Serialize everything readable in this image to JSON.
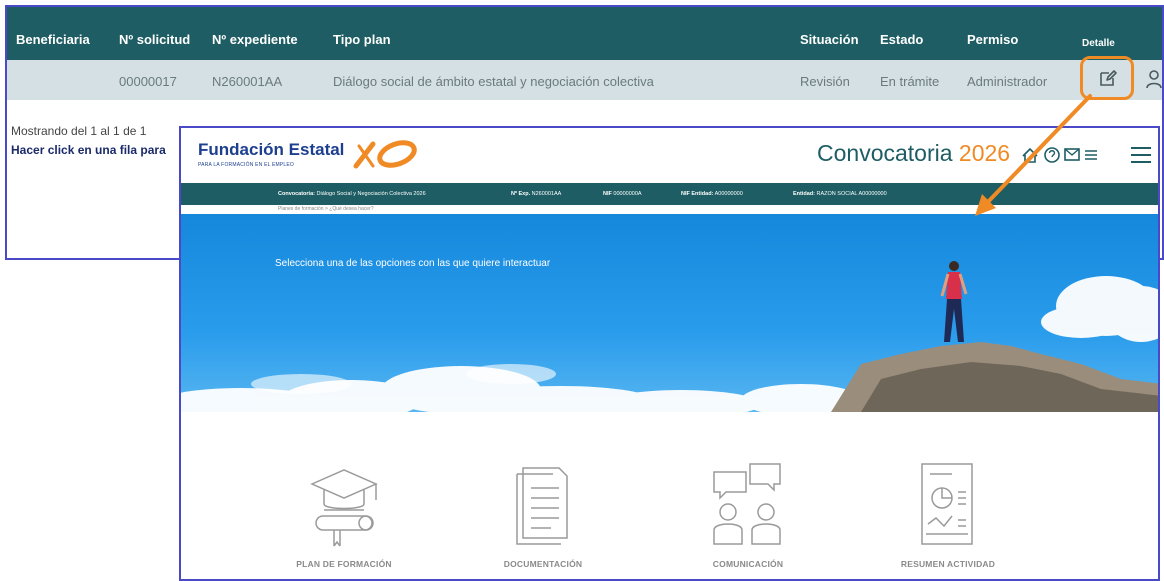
{
  "table": {
    "headers": {
      "beneficiaria": "Beneficiaria",
      "solicitud": "Nº solicitud",
      "expediente": "Nº expediente",
      "tipo_plan": "Tipo plan",
      "situacion": "Situación",
      "estado": "Estado",
      "permiso": "Permiso",
      "detalle": "Detalle"
    },
    "row": {
      "beneficiaria": "",
      "solicitud": "00000017",
      "expediente": "N260001AA",
      "tipo_plan": "Diálogo social de ámbito estatal y negociación colectiva",
      "situacion": "Revisión",
      "estado": "En trámite",
      "permiso": "Administrador"
    },
    "pagination": "Mostrando del 1 al 1 de 1",
    "hint": "Hacer click en una fila para"
  },
  "overlay": {
    "logo_title": "Fundación Estatal",
    "logo_subtitle": "PARA LA FORMACIÓN EN EL EMPLEO",
    "convocatoria_label": "Convocatoria",
    "convocatoria_year": "2026",
    "infobar": {
      "convocatoria_key": "Convocatoria:",
      "convocatoria_val": "Diálogo Social y Negociación Colectiva 2026",
      "exp_key": "Nº Exp.",
      "exp_val": "N260001AA",
      "nif_key": "NIF",
      "nif_val": "00000000A",
      "nif_entidad_key": "NIF Entidad:",
      "nif_entidad_val": "A00000000",
      "entidad_key": "Entidad:",
      "entidad_val": "RAZON SOCIAL A00000000"
    },
    "breadcrumb": "Planes de formación  >  ¿Qué desea hacer?",
    "hero_text": "Selecciona una de las opciones con las que quiere interactuar",
    "tiles": [
      {
        "title": "PLAN DE FORMACIÓN",
        "icon": "graduation-cap-diploma-icon"
      },
      {
        "title": "DOCUMENTACIÓN",
        "icon": "documents-icon"
      },
      {
        "title": "COMUNICACIÓN",
        "icon": "chat-people-icon"
      },
      {
        "title": "RESUMEN ACTIVIDAD",
        "icon": "report-chart-icon"
      }
    ]
  },
  "colors": {
    "header_teal": "#1d5d63",
    "row_bg": "#d4e0e3",
    "accent_orange": "#f08a24",
    "frame_blue": "#4a4ac8",
    "brand_blue": "#1d3f8f"
  }
}
